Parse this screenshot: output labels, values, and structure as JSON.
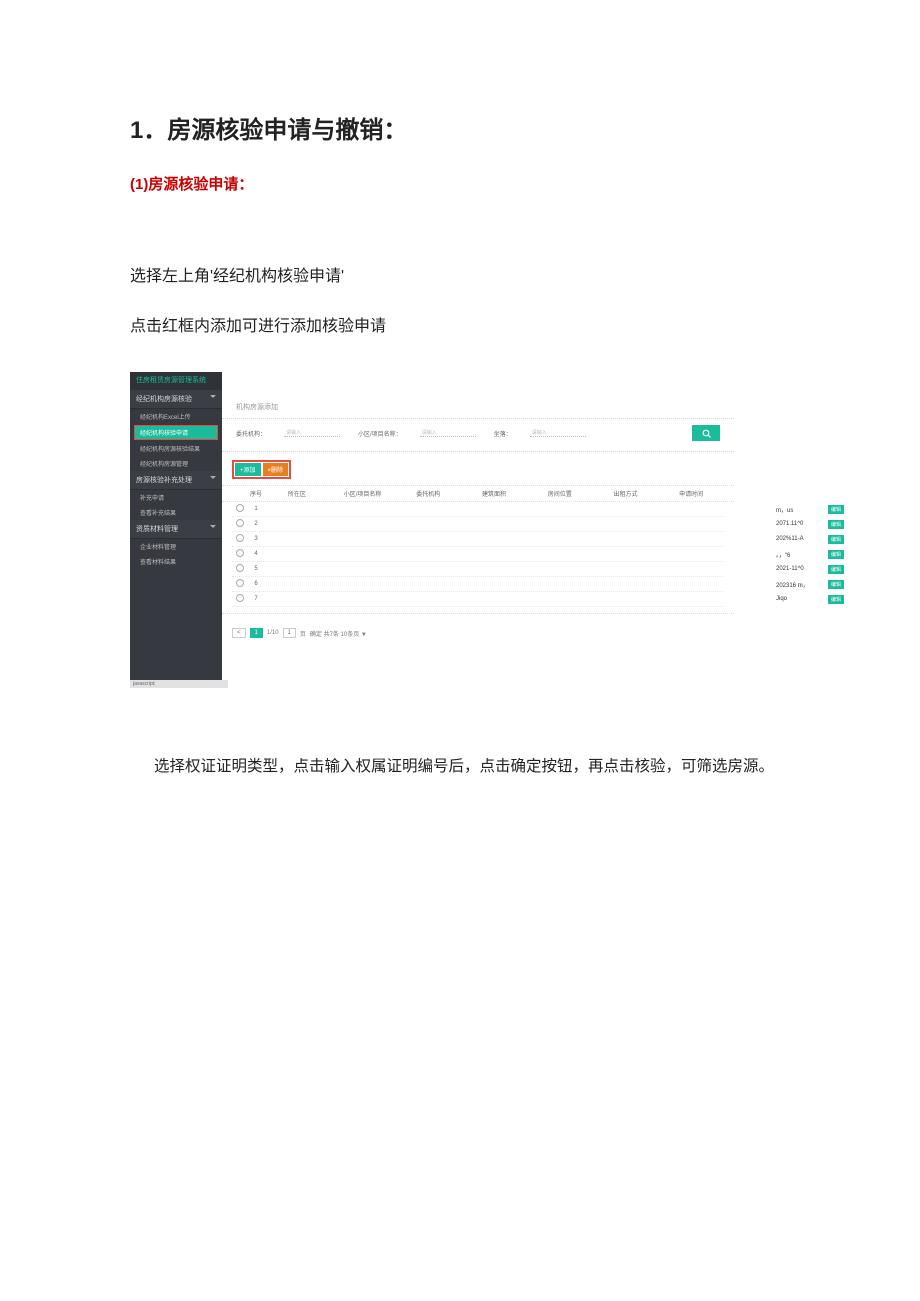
{
  "doc": {
    "heading": "1．房源核验申请与撤销：",
    "sub_heading": "(1)房源核验申请：",
    "para1": "选择左上角'经纪机构核验申请'",
    "para2": "点击红框内添加可进行添加核验申请",
    "para3": "选择权证证明类型，点击输入权属证明编号后，点击确定按钮，再点击核验，可筛选房源。"
  },
  "sidebar": {
    "brand": "住房租赁房源管理系统",
    "g1": "经纪机构房源核验",
    "i1": "经纪机构Excel上传",
    "i2": "经纪机构核验申请",
    "i3": "经纪机构房源核验结果",
    "i4": "经纪机构房源管理",
    "g2": "房源核验补充处理",
    "i5": "补充申请",
    "i6": "查看补充结果",
    "g3": "资质材料管理",
    "i7": "企业材料管理",
    "i8": "查看材料结果"
  },
  "main": {
    "crumb": "机构房源添加",
    "f1_label": "委托机构：",
    "f1_ph": "请输入",
    "f2_label": "小区/项目名称：",
    "f2_ph": "请输入",
    "f3_label": "坐落：",
    "f3_ph": "请输入",
    "add": "+添加",
    "del": "×删除",
    "cols": [
      "序号",
      "所在区",
      "小区/项目名称",
      "委托机构",
      "建筑面积",
      "房间位置",
      "出租方式",
      "申请时间"
    ],
    "rows": [
      {
        "n": "1",
        "t": "m，us",
        "a": "编辑"
      },
      {
        "n": "2",
        "t": "2071.11^0",
        "a": "编辑"
      },
      {
        "n": "3",
        "t": "202%11-A",
        "a": "编辑"
      },
      {
        "n": "4",
        "t": "。，“6",
        "a": "编辑"
      },
      {
        "n": "5",
        "t": "2021-11^0",
        "a": "编辑"
      },
      {
        "n": "6",
        "t": "202316 m，",
        "a": "编辑"
      },
      {
        "n": "7",
        "t": "Jiqo",
        "a": "编辑"
      }
    ],
    "pager": {
      "prev": "<",
      "p1": "1",
      "jump": "1/10",
      "go": "1",
      "of": "页",
      "count": "确定  共7条  10条页 ▼"
    }
  },
  "status": "javascript;"
}
